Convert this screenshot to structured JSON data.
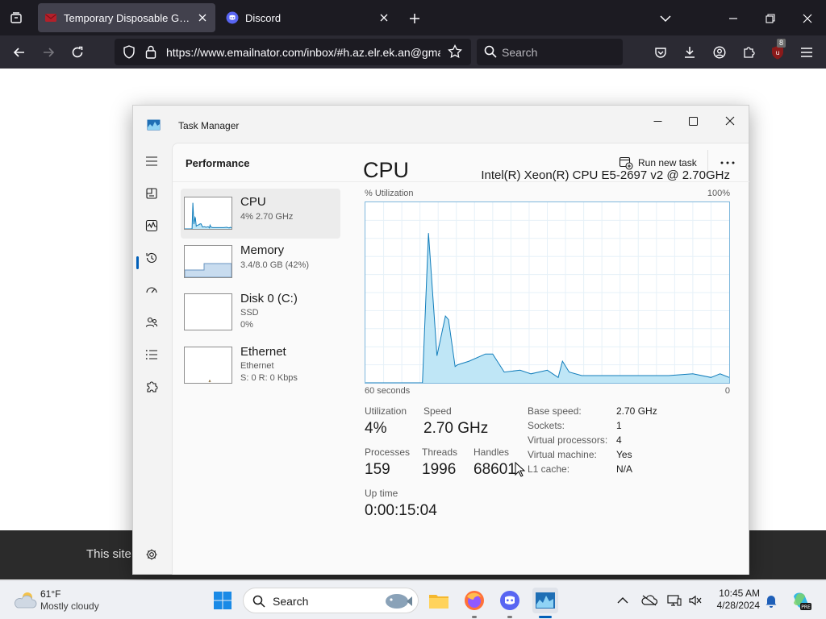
{
  "browser": {
    "tabs": [
      {
        "title": "Temporary Disposable Gmail | T",
        "active": true
      },
      {
        "title": "Discord",
        "active": false
      }
    ],
    "url": "https://www.emailnator.com/inbox/#h.az.elr.ek.an@gmail.com",
    "search_placeholder": "Search",
    "extension_badge": "8"
  },
  "page": {
    "footer_text": "This site"
  },
  "task_manager": {
    "title": "Task Manager",
    "page_title": "Performance",
    "run_new_task": "Run new task",
    "resources": [
      {
        "name": "CPU",
        "line1": "4%  2.70 GHz",
        "line2": ""
      },
      {
        "name": "Memory",
        "line1": "3.4/8.0 GB (42%)",
        "line2": ""
      },
      {
        "name": "Disk 0 (C:)",
        "line1": "SSD",
        "line2": "0%"
      },
      {
        "name": "Ethernet",
        "line1": "Ethernet",
        "line2": "S: 0  R: 0 Kbps"
      }
    ],
    "cpu": {
      "title": "CPU",
      "model": "Intel(R) Xeon(R) CPU E5-2697 v2 @ 2.70GHz",
      "util_label": "% Utilization",
      "util_max": "100%",
      "time_label": "60 seconds",
      "time_end": "0",
      "stats": {
        "utilization": {
          "label": "Utilization",
          "value": "4%"
        },
        "speed": {
          "label": "Speed",
          "value": "2.70 GHz"
        },
        "processes": {
          "label": "Processes",
          "value": "159"
        },
        "threads": {
          "label": "Threads",
          "value": "1996"
        },
        "handles": {
          "label": "Handles",
          "value": "68601"
        },
        "uptime": {
          "label": "Up time",
          "value": "0:00:15:04"
        }
      },
      "specs": [
        {
          "key": "Base speed:",
          "value": "2.70 GHz"
        },
        {
          "key": "Sockets:",
          "value": "1"
        },
        {
          "key": "Virtual processors:",
          "value": "4"
        },
        {
          "key": "Virtual machine:",
          "value": "Yes"
        },
        {
          "key": "L1 cache:",
          "value": "N/A"
        }
      ]
    }
  },
  "chart_data": {
    "type": "area",
    "xlabel": "60 seconds",
    "ylabel": "% Utilization",
    "ylim": [
      0,
      100
    ],
    "xlim": [
      60,
      0
    ],
    "x": [
      60,
      50.6,
      49.6,
      48.2,
      46.8,
      46.3,
      45.2,
      44.8,
      42.9,
      40.2,
      39.0,
      37.1,
      34.5,
      32.7,
      30.0,
      28.2,
      27.5,
      26.4,
      24.3,
      21.0,
      17.0,
      13.5,
      10.0,
      6.0,
      3.0,
      1.5,
      0
    ],
    "values": [
      0,
      0,
      83,
      15,
      37,
      35,
      9,
      10,
      12,
      16,
      16,
      6,
      7,
      5,
      7,
      3,
      12,
      6,
      4,
      4,
      4,
      4,
      4,
      5,
      3,
      5,
      3
    ],
    "grid": true,
    "colors": {
      "line": "#117dbb",
      "fill": "#bfe6f6"
    }
  },
  "taskbar": {
    "weather_temp": "61°F",
    "weather_desc": "Mostly cloudy",
    "search_placeholder": "Search",
    "time": "10:45 AM",
    "date": "4/28/2024",
    "apps": [
      "windows-start-icon",
      "file-explorer-icon",
      "firefox-icon",
      "discord-icon",
      "task-manager-icon"
    ]
  }
}
